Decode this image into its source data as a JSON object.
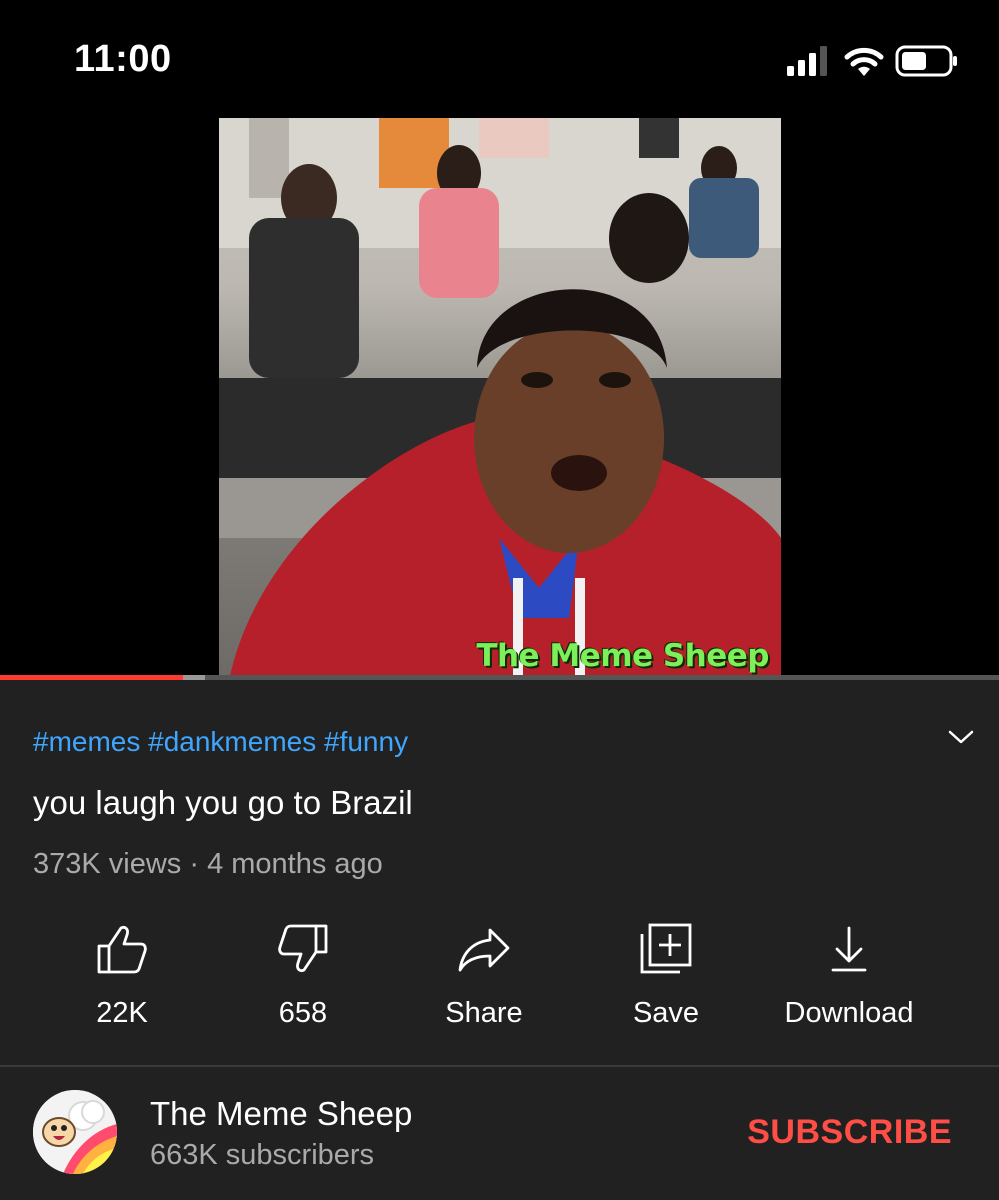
{
  "status_bar": {
    "time": "11:00",
    "icons": [
      "cellular-signal-icon",
      "wifi-icon",
      "battery-icon"
    ]
  },
  "player": {
    "watermark": "The Meme Sheep",
    "progress_fraction": 0.183,
    "buffered_fraction": 0.205,
    "colors": {
      "progress": "#ff3b30",
      "watermark": "#7cf05a"
    }
  },
  "video": {
    "hashtags": "#memes #dankmemes #funny",
    "title": "you laugh you go to Brazil",
    "meta": "373K views · 4 months ago"
  },
  "actions": [
    {
      "icon": "thumbs-up-icon",
      "label": "22K"
    },
    {
      "icon": "thumbs-down-icon",
      "label": "658"
    },
    {
      "icon": "share-icon",
      "label": "Share"
    },
    {
      "icon": "save-playlist-icon",
      "label": "Save"
    },
    {
      "icon": "download-icon",
      "label": "Download"
    }
  ],
  "channel": {
    "name": "The Meme Sheep",
    "subscribers": "663K subscribers",
    "subscribe_label": "SUBSCRIBE",
    "subscribe_color": "#ff4e45"
  },
  "colors": {
    "hashtag": "#3ea6ff",
    "background": "#212121"
  }
}
